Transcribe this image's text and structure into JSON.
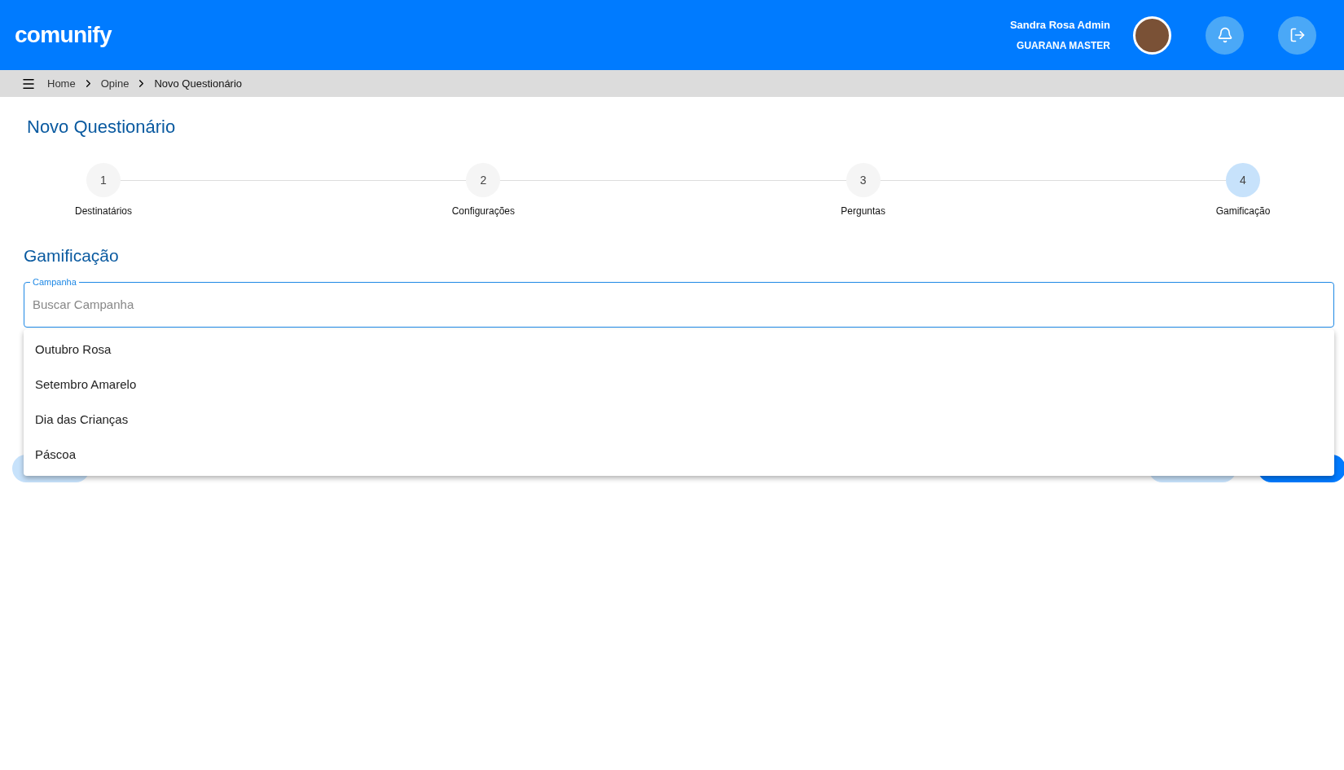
{
  "header": {
    "logo": "comunify",
    "user_name": "Sandra Rosa Admin",
    "user_role": "GUARANA MASTER"
  },
  "breadcrumb": [
    "Home",
    "Opine",
    "Novo Questionário"
  ],
  "page_title": "Novo Questionário",
  "steps": [
    {
      "number": "1",
      "label": "Destinatários",
      "selected": false
    },
    {
      "number": "2",
      "label": "Configurações",
      "selected": false
    },
    {
      "number": "3",
      "label": "Perguntas",
      "selected": false
    },
    {
      "number": "4",
      "label": "Gamificação",
      "selected": true
    }
  ],
  "section_title": "Gamificação",
  "campaign_field": {
    "label": "Campanha",
    "placeholder": "Buscar Campanha"
  },
  "dropdown_options": [
    "Outubro Rosa",
    "Setembro Amarelo",
    "Dia das Crianças",
    "Páscoa"
  ]
}
